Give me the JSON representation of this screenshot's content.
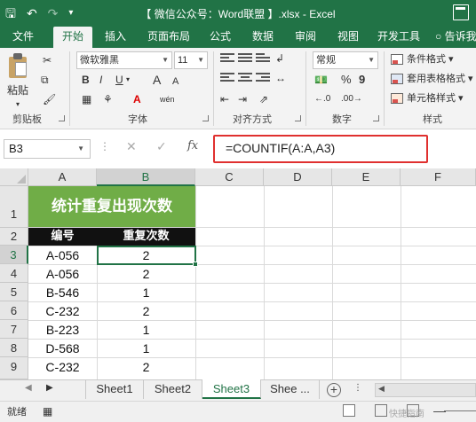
{
  "window": {
    "title": "【 微信公众号：Word联盟 】.xlsx - Excel",
    "qat_icons": [
      "save-icon",
      "undo-icon",
      "redo-icon",
      "customize-icon"
    ]
  },
  "ribbon_tabs": [
    "文件",
    "开始",
    "插入",
    "页面布局",
    "公式",
    "数据",
    "审阅",
    "视图",
    "开发工具",
    "告诉我"
  ],
  "active_tab": "开始",
  "ribbon": {
    "clipboard": {
      "paste_label": "粘贴",
      "group_label": "剪贴板"
    },
    "font": {
      "font_name": "微软雅黑",
      "font_size": "11",
      "bold": "B",
      "italic": "I",
      "underline": "U",
      "grow": "A",
      "shrink": "A",
      "wen": "wén",
      "group_label": "字体"
    },
    "alignment": {
      "group_label": "对齐方式"
    },
    "number": {
      "format": "常规",
      "percent": "%",
      "comma": "9",
      "group_label": "数字"
    },
    "styles": {
      "conditional": "条件格式",
      "table": "套用表格格式",
      "cell": "单元格样式",
      "group_label": "样式"
    }
  },
  "formula_bar": {
    "name_box": "B3",
    "fx": "fx",
    "formula": "=COUNTIF(A:A,A3)"
  },
  "grid": {
    "columns": [
      "A",
      "B",
      "C",
      "D",
      "E",
      "F"
    ],
    "rows": [
      "1",
      "2",
      "3",
      "4",
      "5",
      "6",
      "7",
      "8",
      "9"
    ],
    "title": "统计重复出现次数",
    "headers": [
      "编号",
      "重复次数"
    ],
    "data": [
      [
        "A-056",
        "2"
      ],
      [
        "A-056",
        "2"
      ],
      [
        "B-546",
        "1"
      ],
      [
        "C-232",
        "2"
      ],
      [
        "B-223",
        "1"
      ],
      [
        "D-568",
        "1"
      ],
      [
        "C-232",
        "2"
      ]
    ],
    "selected_cell": "B3",
    "title_fill": "#70ad47",
    "header_fill": "#111111",
    "accent": "#217346"
  },
  "sheets": {
    "tabs": [
      "Sheet1",
      "Sheet2",
      "Sheet3",
      "Shee ..."
    ],
    "active": "Sheet3"
  },
  "status": {
    "ready": "就绪",
    "watermark": "快捷指南"
  }
}
